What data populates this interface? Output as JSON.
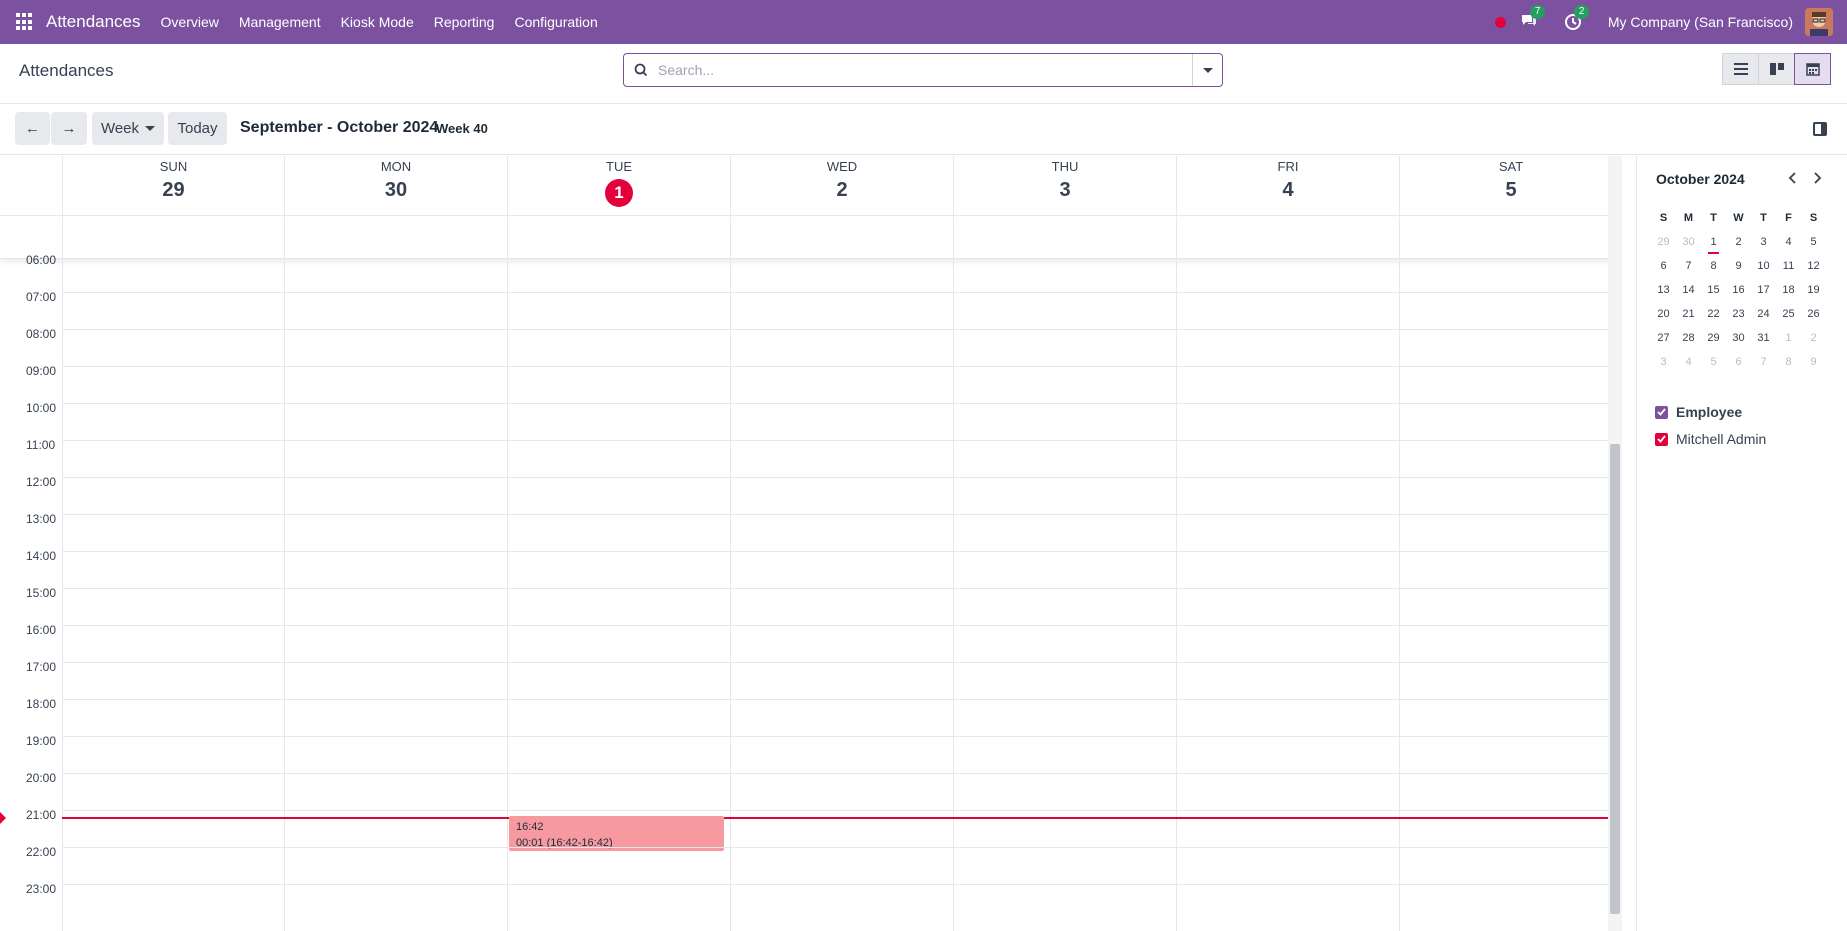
{
  "topnav": {
    "brand": "Attendances",
    "menu": [
      "Overview",
      "Management",
      "Kiosk Mode",
      "Reporting",
      "Configuration"
    ],
    "messages_badge": "7",
    "activity_badge": "2",
    "company": "My Company (San Francisco)"
  },
  "control": {
    "page_title": "Attendances",
    "search_placeholder": "Search..."
  },
  "toolbar": {
    "scale_label": "Week",
    "today_label": "Today",
    "range_title": "September - October 2024",
    "week_label": "Week 40"
  },
  "days": [
    {
      "name": "SUN",
      "num": "29",
      "today": false
    },
    {
      "name": "MON",
      "num": "30",
      "today": false
    },
    {
      "name": "TUE",
      "num": "1",
      "today": true
    },
    {
      "name": "WED",
      "num": "2",
      "today": false
    },
    {
      "name": "THU",
      "num": "3",
      "today": false
    },
    {
      "name": "FRI",
      "num": "4",
      "today": false
    },
    {
      "name": "SAT",
      "num": "5",
      "today": false
    }
  ],
  "hours": [
    "06:00",
    "07:00",
    "08:00",
    "09:00",
    "10:00",
    "11:00",
    "12:00",
    "13:00",
    "14:00",
    "15:00",
    "16:00",
    "17:00",
    "18:00",
    "19:00",
    "20:00",
    "21:00",
    "22:00",
    "23:00"
  ],
  "event": {
    "time": "16:42",
    "detail": "00:01 (16:42-16:42)",
    "color": "#f79aa0"
  },
  "mini_calendar": {
    "title": "October 2024",
    "weekday_headers": [
      "S",
      "M",
      "T",
      "W",
      "T",
      "F",
      "S"
    ],
    "weeks": [
      [
        "29",
        "30",
        "1",
        "2",
        "3",
        "4",
        "5"
      ],
      [
        "6",
        "7",
        "8",
        "9",
        "10",
        "11",
        "12"
      ],
      [
        "13",
        "14",
        "15",
        "16",
        "17",
        "18",
        "19"
      ],
      [
        "20",
        "21",
        "22",
        "23",
        "24",
        "25",
        "26"
      ],
      [
        "27",
        "28",
        "29",
        "30",
        "31",
        "1",
        "2"
      ],
      [
        "3",
        "4",
        "5",
        "6",
        "7",
        "8",
        "9"
      ]
    ]
  },
  "filters": {
    "group_label": "Employee",
    "group_color": "#7c52a0",
    "items": [
      {
        "label": "Mitchell Admin",
        "color": "#e4003a"
      }
    ]
  },
  "colors": {
    "accent": "#7c52a0",
    "today": "#e4003a"
  }
}
